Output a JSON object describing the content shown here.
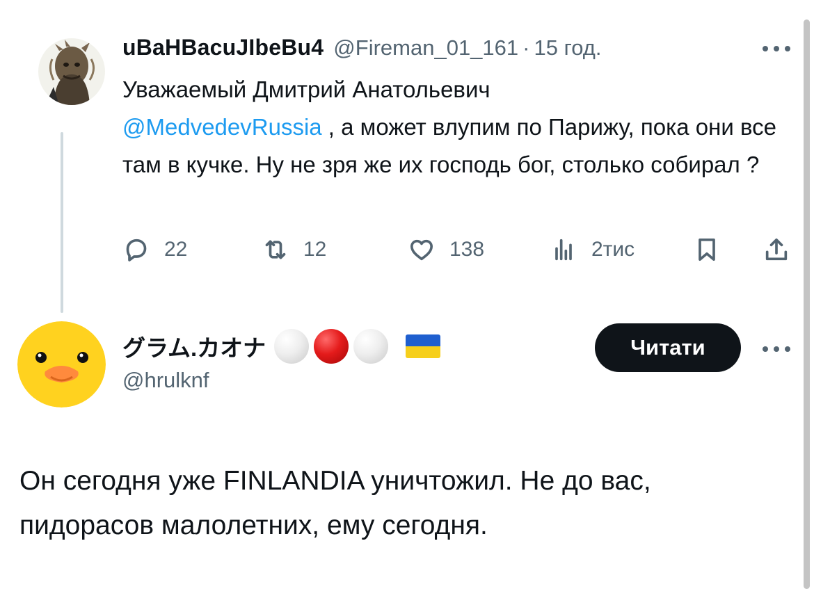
{
  "parent_tweet": {
    "display_name": "uBaHBacuJIbeBu4",
    "handle": "@Fireman_01_161",
    "separator": "·",
    "time": "15 год.",
    "text_before_mention": "Уважаемый Дмитрий Анатольевич",
    "mention": "@MedvedevRussia",
    "text_after_mention": " , а может влупим по Парижу, пока они все там в кучке. Ну не зря же их господь бог, столько собирал ?",
    "actions": {
      "replies": "22",
      "retweets": "12",
      "likes": "138",
      "views": "2тис"
    }
  },
  "reply_tweet": {
    "display_name": "グラム.カオナ",
    "handle": "@hrulknf",
    "follow_label": "Читати",
    "text": "Он сегодня уже FINLANDIA уничтожил. Не до вас, пидорасов малолетних, ему сегодня."
  },
  "colors": {
    "text": "#0f1419",
    "secondary": "#536471",
    "link": "#1d9bf0",
    "thread_line": "#cfd9de",
    "button_bg": "#0f1419"
  },
  "icons": [
    "reply-icon",
    "retweet-icon",
    "like-icon",
    "views-icon",
    "bookmark-icon",
    "share-icon",
    "more-icon"
  ]
}
